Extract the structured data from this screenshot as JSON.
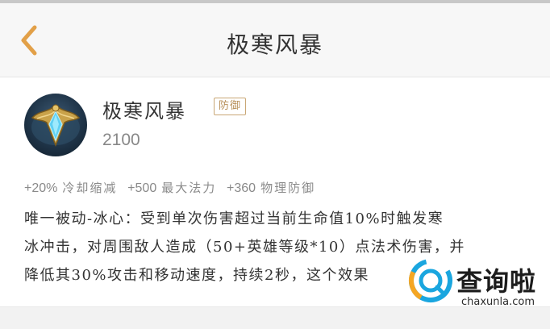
{
  "header": {
    "title": "极寒风暴",
    "back_icon": "chevron-left-icon"
  },
  "item": {
    "name": "极寒风暴",
    "tag": "防御",
    "price": "2100",
    "icon": "frost-storm-item-icon"
  },
  "stats": [
    {
      "value": "+20%",
      "label": "冷却缩减"
    },
    {
      "value": "+500",
      "label": "最大法力"
    },
    {
      "value": "+360",
      "label": "物理防御"
    }
  ],
  "description": {
    "lines": [
      "唯一被动-冰心：受到单次伤害超过当前生命值10%时触发寒",
      "冰冲击，对周围敌人造成（50+英雄等级*10）点法术伤害，并",
      "降低其30%攻击和移动速度，持续2秒，这个效果"
    ]
  },
  "watermark": {
    "text_cn": "查询啦",
    "text_en": "chaxunla.com"
  },
  "colors": {
    "accent": "#e2a048",
    "tag": "#b8905a",
    "watermark_blue": "#1aa6df"
  }
}
